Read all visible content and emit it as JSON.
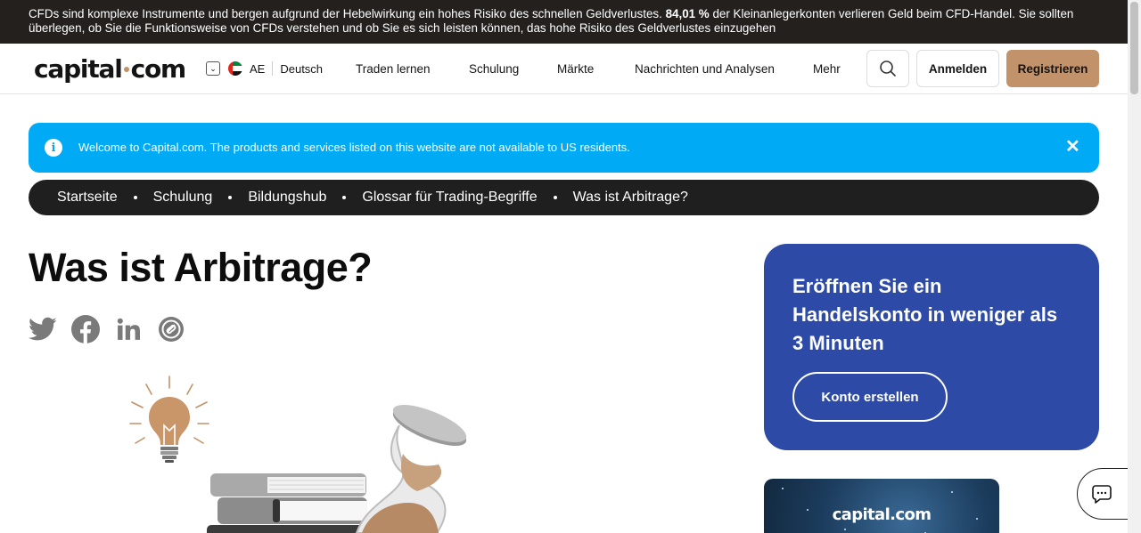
{
  "risk_warning": {
    "before": "CFDs sind komplexe Instrumente und bergen aufgrund der Hebelwirkung ein hohes Risiko des schnellen Geldverlustes.",
    "percent": "84,01 %",
    "after": "der Kleinanlegerkonten verlieren Geld beim CFD-Handel. Sie sollten überlegen, ob Sie die Funktionsweise von CFDs verstehen und ob Sie es sich leisten können, das hohe Risiko des Geldverlustes einzugehen"
  },
  "header": {
    "logo_left": "capital",
    "logo_right": "com",
    "region_code": "AE",
    "language": "Deutsch",
    "nav": [
      "Traden lernen",
      "Schulung",
      "Märkte",
      "Nachrichten und Analysen",
      "Mehr"
    ],
    "login_label": "Anmelden",
    "register_label": "Registrieren"
  },
  "notice": {
    "message": "Welcome to Capital.com. The products and services listed on this website are not available to US residents.",
    "close_symbol": "✕",
    "info_symbol": "i"
  },
  "breadcrumb": [
    "Startseite",
    "Schulung",
    "Bildungshub",
    "Glossar für Trading-Begriffe",
    "Was ist Arbitrage?"
  ],
  "page": {
    "title": "Was ist Arbitrage?"
  },
  "socials": [
    "twitter-icon",
    "facebook-icon",
    "linkedin-icon",
    "copy-link-icon"
  ],
  "cta": {
    "heading": "Eröffnen Sie ein Handelskonto in weniger als 3 Minuten",
    "button_label": "Konto erstellen"
  },
  "promo": {
    "brand_left": "capital",
    "brand_right": "com"
  },
  "colors": {
    "accent": "#c2926a",
    "notice": "#00aaf5",
    "cta": "#2c4aa6",
    "dark": "#23201e"
  }
}
